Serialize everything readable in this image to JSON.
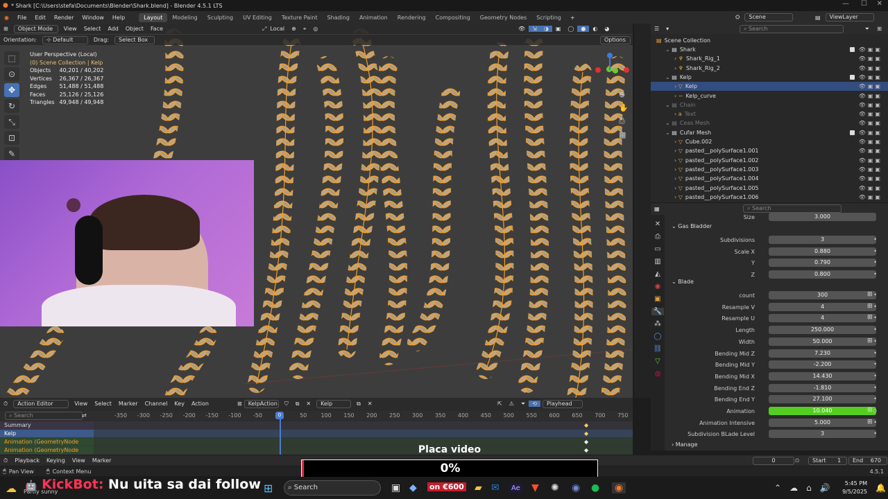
{
  "window": {
    "title": "* Shark [C:\\Users\\stefa\\Documents\\Blender\\Shark.blend] - Blender 4.5.1 LTS"
  },
  "menu": {
    "items": [
      "File",
      "Edit",
      "Render",
      "Window",
      "Help"
    ],
    "workspaces": [
      "Layout",
      "Modeling",
      "Sculpting",
      "UV Editing",
      "Texture Paint",
      "Shading",
      "Animation",
      "Rendering",
      "Compositing",
      "Geometry Nodes",
      "Scripting"
    ],
    "scene": "Scene",
    "view_layer": "ViewLayer"
  },
  "viewport": {
    "mode": "Object Mode",
    "menus": [
      "View",
      "Select",
      "Add",
      "Object",
      "Face"
    ],
    "transform": "Local",
    "orientation_label": "Orientation:",
    "orientation": "Default",
    "drag_label": "Drag:",
    "drag": "Select Box",
    "options": "Options",
    "perspective": "User Perspective (Local)",
    "collection": "(0) Scene Collection | Kelp",
    "stats": [
      {
        "label": "Objects",
        "value": "40,201 / 40,202"
      },
      {
        "label": "Vertices",
        "value": "26,367 / 26,367"
      },
      {
        "label": "Edges",
        "value": "51,488 / 51,488"
      },
      {
        "label": "Faces",
        "value": "25,126 / 25,126"
      },
      {
        "label": "Triangles",
        "value": "49,948 / 49,948"
      }
    ],
    "colors": {
      "kelp": "#f0a030",
      "bg": "#3d3d3d"
    }
  },
  "outliner": {
    "search_placeholder": "Search",
    "root": "Scene Collection",
    "rows": [
      {
        "name": "Shark",
        "indent": 1,
        "dim": false,
        "sel": false,
        "icon": "collection-icon",
        "check": true
      },
      {
        "name": "Shark_Rig_1",
        "indent": 2,
        "dim": false,
        "sel": false,
        "icon": "armature-icon",
        "check": false
      },
      {
        "name": "Shark_Rig_2",
        "indent": 2,
        "dim": false,
        "sel": false,
        "icon": "armature-icon",
        "check": false
      },
      {
        "name": "Kelp",
        "indent": 1,
        "dim": false,
        "sel": false,
        "icon": "collection-icon",
        "check": true
      },
      {
        "name": "Kelp",
        "indent": 2,
        "dim": false,
        "sel": true,
        "icon": "mesh-icon",
        "check": false
      },
      {
        "name": "Kelp_curve",
        "indent": 2,
        "dim": false,
        "sel": false,
        "icon": "curve-icon",
        "check": false
      },
      {
        "name": "Chain",
        "indent": 1,
        "dim": true,
        "sel": false,
        "icon": "collection-icon",
        "check": false
      },
      {
        "name": "Text",
        "indent": 2,
        "dim": true,
        "sel": false,
        "icon": "text-icon",
        "check": false
      },
      {
        "name": "Ceas Mesh",
        "indent": 1,
        "dim": true,
        "sel": false,
        "icon": "collection-icon",
        "check": false
      },
      {
        "name": "Cufar Mesh",
        "indent": 1,
        "dim": false,
        "sel": false,
        "icon": "collection-icon",
        "check": true
      },
      {
        "name": "Cube.002",
        "indent": 2,
        "dim": false,
        "sel": false,
        "icon": "mesh-icon",
        "check": false
      },
      {
        "name": "pasted__polySurface1.001",
        "indent": 2,
        "dim": false,
        "sel": false,
        "icon": "mesh-icon",
        "check": false
      },
      {
        "name": "pasted__polySurface1.002",
        "indent": 2,
        "dim": false,
        "sel": false,
        "icon": "mesh-icon",
        "check": false
      },
      {
        "name": "pasted__polySurface1.003",
        "indent": 2,
        "dim": false,
        "sel": false,
        "icon": "mesh-icon",
        "check": false
      },
      {
        "name": "pasted__polySurface1.004",
        "indent": 2,
        "dim": false,
        "sel": false,
        "icon": "mesh-icon",
        "check": false
      },
      {
        "name": "pasted__polySurface1.005",
        "indent": 2,
        "dim": false,
        "sel": false,
        "icon": "mesh-icon",
        "check": false
      },
      {
        "name": "pasted__polySurface1.006",
        "indent": 2,
        "dim": false,
        "sel": false,
        "icon": "mesh-icon",
        "check": false
      }
    ]
  },
  "properties": {
    "search_placeholder": "Search",
    "size_value": "3.000",
    "gas_bladder": {
      "title": "Gas Bladder",
      "rows": [
        {
          "label": "Subdivisions",
          "value": "3"
        },
        {
          "label": "Scale X",
          "value": "0.880"
        },
        {
          "label": "Y",
          "value": "0.790"
        },
        {
          "label": "Z",
          "value": "0.800"
        }
      ]
    },
    "blade": {
      "title": "Blade",
      "rows": [
        {
          "label": "count",
          "value": "300",
          "kf": true
        },
        {
          "label": "Resample V",
          "value": "4",
          "kf": true
        },
        {
          "label": "Resample U",
          "value": "4",
          "kf": true
        },
        {
          "label": "Length",
          "value": "250.000",
          "kf": false
        },
        {
          "label": "Width",
          "value": "50.000",
          "kf": true
        },
        {
          "label": "Bending Mid Z",
          "value": "7.230",
          "kf": false
        },
        {
          "label": "Bending Mid Y",
          "value": "-2.200",
          "kf": false
        },
        {
          "label": "Bending Mid X",
          "value": "14.430",
          "kf": false
        },
        {
          "label": "Bending End Z",
          "value": "-1.810",
          "kf": false
        },
        {
          "label": "Bending End Y",
          "value": "27.100",
          "kf": false
        },
        {
          "label": "Animation",
          "value": "10.040",
          "kf": true,
          "anim": true
        },
        {
          "label": "Animation Intensive",
          "value": "5.000",
          "kf": true
        },
        {
          "label": "Subdivision BLade Level",
          "value": "3",
          "kf": false
        }
      ]
    },
    "manage": "Manage"
  },
  "timeline": {
    "editor": "Action Editor",
    "menus": [
      "View",
      "Select",
      "Marker",
      "Channel",
      "Key",
      "Action"
    ],
    "action": "KelpAction",
    "object": "Kelp",
    "playhead_mode": "Playhead",
    "search_placeholder": "Search",
    "ticks": [
      "-350",
      "-300",
      "-250",
      "-200",
      "-150",
      "-100",
      "-50",
      "0",
      "50",
      "100",
      "150",
      "200",
      "250",
      "300",
      "350",
      "400",
      "450",
      "500",
      "550",
      "600",
      "650",
      "700",
      "750"
    ],
    "current_frame": "0",
    "channels": [
      "Summary",
      "Kelp",
      "Animation (GeometryNode",
      "Animation (GeometryNode"
    ]
  },
  "playback": {
    "menus": [
      "Playback",
      "Keying",
      "View",
      "Marker"
    ],
    "frame": "0",
    "start_label": "Start",
    "start": "1",
    "end_label": "End",
    "end": "670"
  },
  "status": {
    "left": "Pan View",
    "middle": "Context Menu",
    "version": "4.5.1"
  },
  "overlay": {
    "title": "Placa video",
    "percent": "0%",
    "progress": 0.0
  },
  "taskbar": {
    "kickbot": "KickBot:",
    "message": "Nu uita sa dai follow",
    "weather": "Partly sunny",
    "search": "Search",
    "promo": "on €600",
    "time": "5:45 PM",
    "date": "9/5/2025"
  }
}
